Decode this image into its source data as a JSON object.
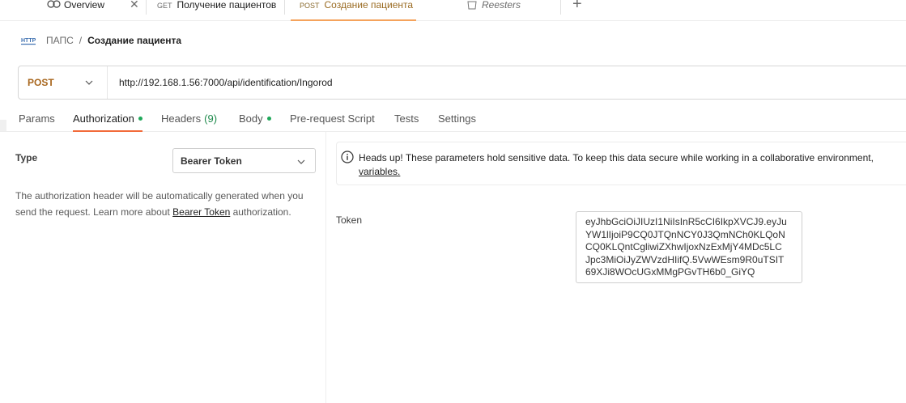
{
  "tabs": {
    "overview": {
      "label": "Overview"
    },
    "get_patients": {
      "method": "GET",
      "label": "Получение пациентов"
    },
    "post_create": {
      "method": "POST",
      "label": "Создание пациента"
    },
    "reesters": {
      "label": "Reesters"
    }
  },
  "breadcrumb": {
    "icon_text": "HTTP",
    "parent": "ПАПС",
    "separator": "/",
    "current": "Создание пациента"
  },
  "request": {
    "method": "POST",
    "url": "http://192.168.1.56:7000/api/identification/Ingorod"
  },
  "request_tabs": {
    "params": "Params",
    "authorization": "Authorization",
    "headers": "Headers",
    "headers_count": "(9)",
    "body": "Body",
    "pre_request": "Pre-request Script",
    "tests": "Tests",
    "settings": "Settings"
  },
  "auth": {
    "type_label": "Type",
    "type_value": "Bearer Token",
    "description_before": "The authorization header will be automatically generated when you send the request. Learn more about ",
    "description_link": "Bearer Token",
    "description_after": " authorization."
  },
  "notice": {
    "text": "Heads up! These parameters hold sensitive data. To keep this data secure while working in a collaborative environment,",
    "link": "variables."
  },
  "token": {
    "label": "Token",
    "lines": [
      "eyJhbGciOiJIUzI1NiIsInR5cCI6IkpXVCJ9.eyJu",
      "YW1lIjoiP9CQ0JTQnNCY0J3QmNCh0KLQoN",
      "CQ0KLQntCgliwiZXhwIjoxNzExMjY4MDc5LC",
      "Jpc3MiOiJyZWVzdHIifQ.5VwWEsm9R0uTSIT",
      "69XJi8WOcUGxMMgPGvTH6b0_GiYQ"
    ]
  },
  "colors": {
    "accent": "#f26b3a",
    "post_method": "#a8661d",
    "dot_green": "#1fa85a"
  }
}
